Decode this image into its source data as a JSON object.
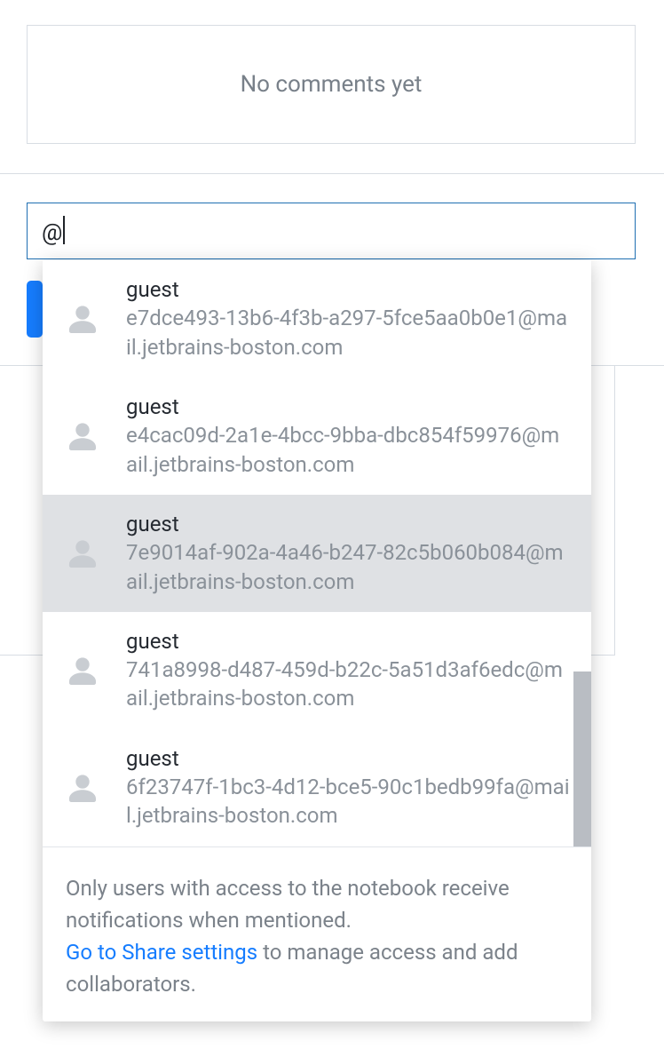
{
  "comments": {
    "empty_text": "No comments yet"
  },
  "input": {
    "value": "@"
  },
  "dropdown": {
    "items": [
      {
        "name": "guest",
        "email": "e7dce493-13b6-4f3b-a297-5fce5aa0b0e1@mail.jetbrains-boston.com",
        "highlighted": false
      },
      {
        "name": "guest",
        "email": "e4cac09d-2a1e-4bcc-9bba-dbc854f59976@mail.jetbrains-boston.com",
        "highlighted": false
      },
      {
        "name": "guest",
        "email": "7e9014af-902a-4a46-b247-82c5b060b084@mail.jetbrains-boston.com",
        "highlighted": true
      },
      {
        "name": "guest",
        "email": "741a8998-d487-459d-b22c-5a51d3af6edc@mail.jetbrains-boston.com",
        "highlighted": false
      },
      {
        "name": "guest",
        "email": "6f23747f-1bc3-4d12-bce5-90c1bedb99fa@mail.jetbrains-boston.com",
        "highlighted": false
      }
    ],
    "footer": {
      "line1": "Only users with access to the notebook receive notifications when mentioned.",
      "link_text": "Go to Share settings",
      "line2_rest": " to manage access and add collaborators."
    }
  }
}
